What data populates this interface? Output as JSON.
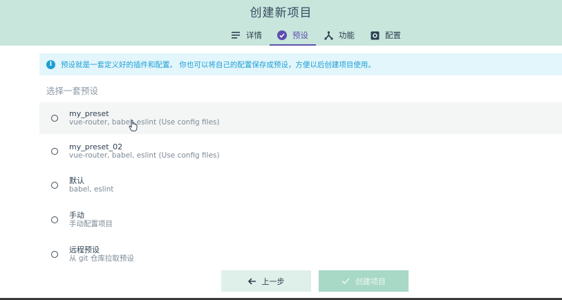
{
  "header": {
    "title": "创建新项目",
    "tabs": [
      {
        "label": "详情",
        "icon": "list-icon"
      },
      {
        "label": "预设",
        "icon": "check-circle-icon",
        "active": true
      },
      {
        "label": "功能",
        "icon": "fork-icon"
      },
      {
        "label": "配置",
        "icon": "gear-icon"
      }
    ]
  },
  "info": {
    "icon": "info-icon",
    "text": "预设就是一套定义好的插件和配置。 你也可以将自己的配置保存成预设，方便以后创建项目使用。"
  },
  "section": {
    "title": "选择一套预设"
  },
  "presets": [
    {
      "name": "my_preset",
      "desc": "vue-router, babel, eslint (Use config files)"
    },
    {
      "name": "my_preset_02",
      "desc": "vue-router, babel, eslint (Use config files)"
    },
    {
      "name": "默认",
      "desc": "babel, eslint"
    },
    {
      "name": "手动",
      "desc": "手动配置项目"
    },
    {
      "name": "远程预设",
      "desc": "从 git 仓库拉取预设"
    }
  ],
  "footer": {
    "prev_label": "上一步",
    "create_label": "创建项目"
  },
  "colors": {
    "header_bg": "#c8e6dc",
    "accent": "#5d4fb0",
    "info_bg": "#e2f6fb",
    "info_text": "#1e9ed6",
    "create_btn_bg": "#a8d8c6"
  }
}
